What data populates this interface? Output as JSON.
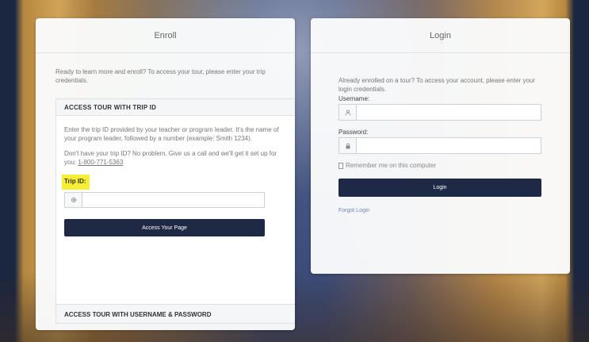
{
  "enroll": {
    "title": "Enroll",
    "intro": "Ready to learn more and enroll? To access your tour, please enter your trip credentials.",
    "trip_section": {
      "heading": "ACCESS TOUR WITH TRIP ID",
      "description": "Enter the trip ID provided by your teacher or program leader. It's the name of your program leader, followed by a number (example: Smith 1234).",
      "help_prefix": "Don't have your trip ID? No problem. Give us a call and we'll get it set up for you: ",
      "help_phone": "1-800-771-5363",
      "field_label": "Trip ID:",
      "field_icon": "gear-icon",
      "field_value": "",
      "button_label": "Access Your Page"
    },
    "user_section": {
      "heading": "ACCESS TOUR WITH USERNAME & PASSWORD"
    }
  },
  "login": {
    "title": "Login",
    "intro": "Already enrolled on a tour? To access your account, please enter your login credentials.",
    "username_label": "Username:",
    "username_icon": "user-icon",
    "username_value": "",
    "password_label": "Password:",
    "password_icon": "lock-icon",
    "password_value": "",
    "remember_label": "Remember me on this computer",
    "button_label": "Login",
    "forgot_label": "Forgot Login"
  },
  "colors": {
    "button": "#1e2a45",
    "highlight": "#f6ef33",
    "link": "#6a8bb8"
  }
}
